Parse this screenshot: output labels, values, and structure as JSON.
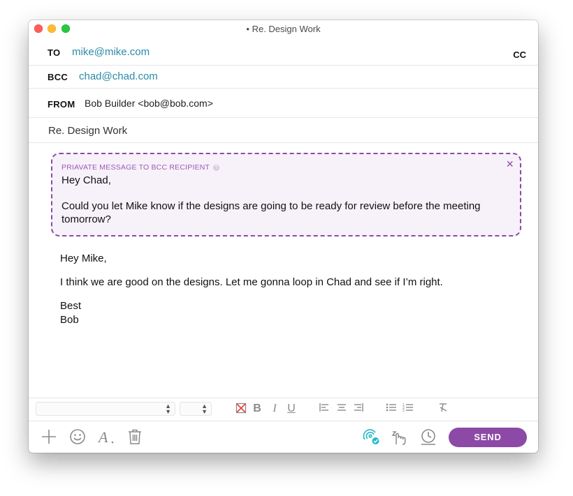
{
  "window": {
    "title": "• Re. Design Work"
  },
  "compose": {
    "to_label": "TO",
    "to_value": "mike@mike.com",
    "cc_label": "CC",
    "bcc_label": "BCC",
    "bcc_value": "chad@chad.com",
    "from_label": "FROM",
    "from_value": "Bob Builder <bob@bob.com>",
    "subject": "Re. Design Work"
  },
  "private_message": {
    "header": "PRIAVATE MESSAGE TO BCC RECIPIENT",
    "help_glyph": "?",
    "close_glyph": "×",
    "greeting": "Hey Chad,",
    "body": "Could you let Mike know if the designs are going to be ready for review before the meeting tomorrow?"
  },
  "message": {
    "greeting": "Hey Mike,",
    "body": "I think we are good on the designs. Let me gonna loop in Chad and see if I’m right.",
    "closing": "Best",
    "signature": "Bob"
  },
  "format_toolbar": {
    "font_select_value": "",
    "size_select_value": "",
    "icons": [
      "clear-color-icon",
      "bold-icon",
      "italic-icon",
      "underline-icon",
      "align-left-icon",
      "align-center-icon",
      "align-right-icon",
      "bullet-list-icon",
      "numbered-list-icon",
      "clear-format-icon"
    ],
    "bold_glyph": "B",
    "italic_glyph": "I",
    "underline_glyph": "U"
  },
  "bottom_toolbar": {
    "icons": [
      "add-icon",
      "emoji-icon",
      "font-icon",
      "trash-icon",
      "read-receipt-icon",
      "snooze-icon",
      "schedule-icon"
    ],
    "send_label": "SEND"
  },
  "colors": {
    "accent_purple": "#8c49a6",
    "link_blue": "#2c8aa8",
    "teal": "#22b8c9",
    "private_bg": "#f7f1f9"
  }
}
